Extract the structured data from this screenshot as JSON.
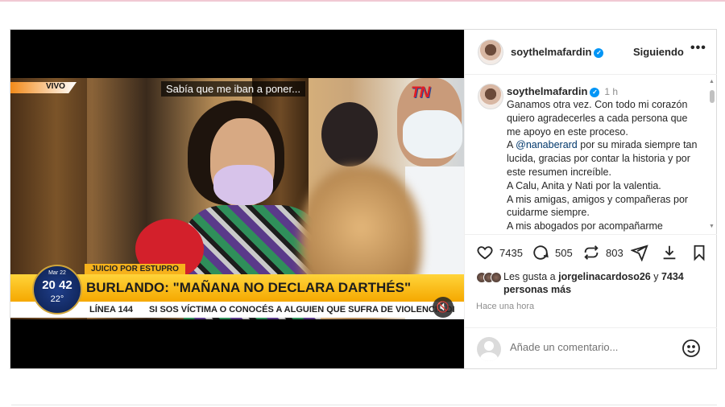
{
  "post": {
    "username": "soythelmafardin",
    "follow_label": "Siguiendo",
    "more_label": "•••",
    "verified_glyph": "✓",
    "caption_time": "1 h",
    "caption_lines": [
      "Ganamos otra vez. Con todo mi corazón quiero agradecerles a cada persona que me apoyo en este proceso.",
      "por su mirada siempre tan lucida, gracias por contar la historia y por este resumen increíble.",
      "A Calu, Anita y Nati por la valentia.",
      "A mis amigas, amigos y compañeras por cuidarme siempre.",
      "A mis abogados por acompañarme"
    ],
    "caption_prefix_a": "A ",
    "mention": "@nanaberard",
    "stats": {
      "likes": "7435",
      "comments": "505",
      "reposts": "803"
    },
    "likes_text_prefix": "Les gusta a ",
    "likes_user": "jorgelinacardoso26",
    "likes_mid": " y ",
    "likes_others": "7434 personas más",
    "posted_ago": "Hace una hora",
    "comment_placeholder": "Añade un comentario...",
    "icons": [
      "heart-icon",
      "comment-icon",
      "repost-icon",
      "send-icon",
      "download-icon",
      "bookmark-icon",
      "emoji-icon",
      "mute-icon",
      "verified-icon"
    ]
  },
  "video": {
    "live_label": "VIVO",
    "subtitle": "Sabía que me iban a poner...",
    "channel_logo": "TN",
    "tag": "JUICIO POR ESTUPRO",
    "headline": "BURLANDO: \"MAÑANA NO DECLARA DARTHÉS\"",
    "clock_day": "Mar 22",
    "clock_time": "20 42",
    "clock_temp": "22°",
    "ticker_label": "LÍNEA 144",
    "ticker_text": "SI SOS VÍCTIMA O CONOCÉS A ALGUIEN QUE SUFRA DE VIOLENCIA DI",
    "mute_glyph": "🔇"
  },
  "colors": {
    "accent": "#0095f6",
    "mention": "#00376b",
    "headline_bar": "#f5a800",
    "tn_red": "#e21d24"
  }
}
